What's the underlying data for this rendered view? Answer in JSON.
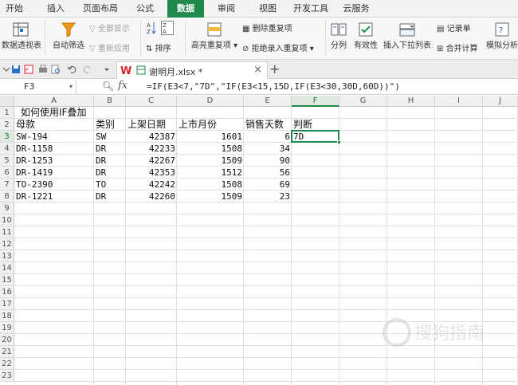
{
  "menu": {
    "tabs": [
      "开始",
      "插入",
      "页面布局",
      "公式",
      "数据",
      "审阅",
      "视图",
      "开发工具",
      "云服务"
    ],
    "active": "数据"
  },
  "ribbon": {
    "pivot": "数据透视表",
    "autofilter": "自动筛选",
    "show_all": "全部显示",
    "reapply": "重新应用",
    "sort": "排序",
    "highlight_dup": "高亮重复项",
    "delete_dup": "删除重复项",
    "reject_dup": "拒绝录入重复项",
    "split": "分列",
    "validity": "有效性",
    "insert_dropdown": "插入下拉列表",
    "merge_calc": "合并计算",
    "record": "记录单",
    "simulate": "模拟分析"
  },
  "file": {
    "name": "谢明月.xlsx *"
  },
  "formula_bar": {
    "cell_ref": "F3",
    "formula": "=IF(E3<7,\"7D\",\"IF(E3<15,15D,IF(E3<30,30D,60D))\")"
  },
  "columns": [
    "A",
    "B",
    "C",
    "D",
    "E",
    "F",
    "G",
    "H",
    "I",
    "J"
  ],
  "rows": [
    "1",
    "2",
    "3",
    "4",
    "5",
    "6",
    "7",
    "8",
    "9",
    "10",
    "11",
    "12",
    "13",
    "14",
    "15",
    "16",
    "17",
    "18",
    "19",
    "20",
    "21",
    "22",
    "23"
  ],
  "sheet": {
    "a1": "如何使用IF叠加",
    "headers": {
      "a": "母款",
      "b": "类别",
      "c": "上架日期",
      "d": "上市月份",
      "e": "销售天数",
      "f": "判断"
    },
    "data": [
      {
        "a": "SW-194",
        "b": "SW",
        "c": "42387",
        "d": "1601",
        "e": "6",
        "f": "7D"
      },
      {
        "a": "DR-1158",
        "b": "DR",
        "c": "42233",
        "d": "1508",
        "e": "34",
        "f": ""
      },
      {
        "a": "DR-1253",
        "b": "DR",
        "c": "42267",
        "d": "1509",
        "e": "90",
        "f": ""
      },
      {
        "a": "DR-1419",
        "b": "DR",
        "c": "42353",
        "d": "1512",
        "e": "56",
        "f": ""
      },
      {
        "a": "TO-2390",
        "b": "TO",
        "c": "42242",
        "d": "1508",
        "e": "69",
        "f": ""
      },
      {
        "a": "DR-1221",
        "b": "DR",
        "c": "42260",
        "d": "1509",
        "e": "23",
        "f": ""
      }
    ]
  },
  "watermark": "搜狗指南"
}
